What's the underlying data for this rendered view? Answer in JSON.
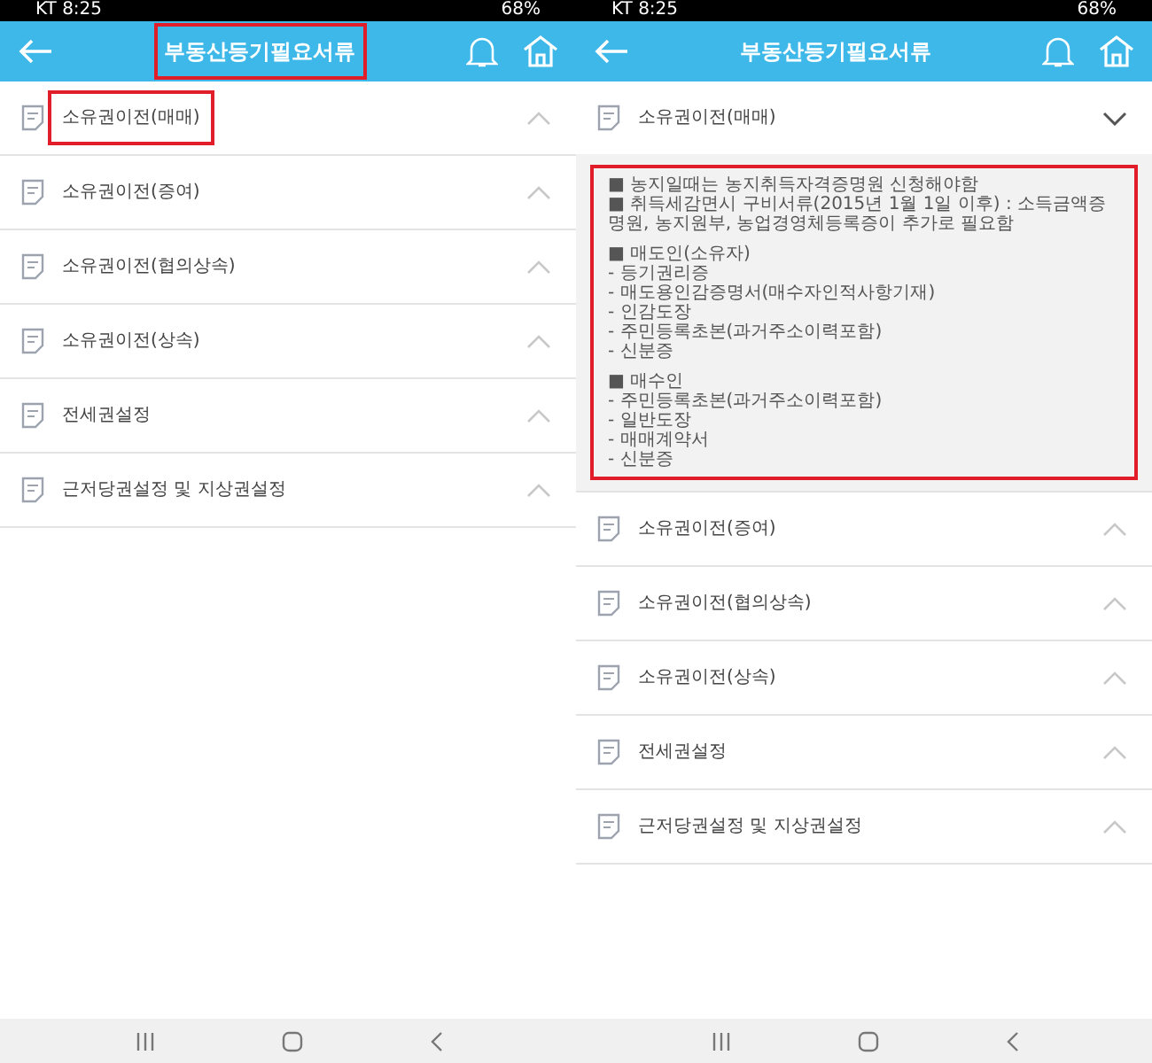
{
  "screens": [
    {
      "status_bar": {
        "time": "KT 8:25",
        "battery": "68%"
      },
      "header": {
        "title": "부동산등기필요서류",
        "highlighted": true
      },
      "items": [
        {
          "label": "소유권이전(매매)",
          "expanded": false,
          "highlighted": true
        },
        {
          "label": "소유권이전(증여)",
          "expanded": false,
          "highlighted": false
        },
        {
          "label": "소유권이전(협의상속)",
          "expanded": false,
          "highlighted": false
        },
        {
          "label": "소유권이전(상속)",
          "expanded": false,
          "highlighted": false
        },
        {
          "label": "전세권설정",
          "expanded": false,
          "highlighted": false
        },
        {
          "label": "근저당권설정 및 지상권설정",
          "expanded": false,
          "highlighted": false
        }
      ]
    },
    {
      "status_bar": {
        "time": "KT 8:25",
        "battery": "68%"
      },
      "header": {
        "title": "부동산등기필요서류",
        "highlighted": false
      },
      "items": [
        {
          "label": "소유권이전(매매)",
          "expanded": true,
          "highlighted": false,
          "content": {
            "highlighted": true,
            "groups": [
              [
                "■ 농지일때는 농지취득자격증명원 신청해야함",
                "■ 취득세감면시 구비서류(2015년 1월 1일 이후) : 소득금액증명원, 농지원부, 농업경영체등록증이 추가로 필요함"
              ],
              [
                "■ 매도인(소유자)",
                "- 등기권리증",
                "- 매도용인감증명서(매수자인적사항기재)",
                "- 인감도장",
                "- 주민등록초본(과거주소이력포함)",
                "- 신분증"
              ],
              [
                "■ 매수인",
                "- 주민등록초본(과거주소이력포함)",
                "- 일반도장",
                "- 매매계약서",
                "- 신분증"
              ]
            ]
          }
        },
        {
          "label": "소유권이전(증여)",
          "expanded": false,
          "highlighted": false
        },
        {
          "label": "소유권이전(협의상속)",
          "expanded": false,
          "highlighted": false
        },
        {
          "label": "소유권이전(상속)",
          "expanded": false,
          "highlighted": false
        },
        {
          "label": "전세권설정",
          "expanded": false,
          "highlighted": false
        },
        {
          "label": "근저당권설정 및 지상권설정",
          "expanded": false,
          "highlighted": false
        }
      ]
    }
  ]
}
